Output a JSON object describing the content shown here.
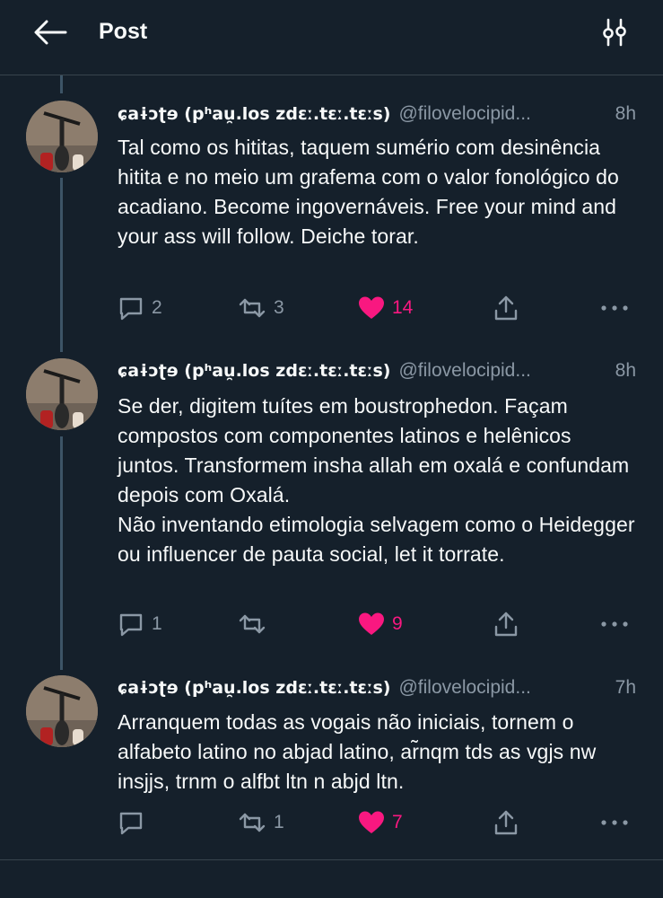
{
  "header": {
    "title": "Post",
    "back_icon": "arrow-left-icon",
    "settings_icon": "sliders-icon"
  },
  "colors": {
    "background": "#15202b",
    "text": "#f7f9f9",
    "muted": "#8b98a5",
    "like": "#f91880",
    "divider": "#38444d"
  },
  "tweets": [
    {
      "name": "ɕaɨɔʈɘ (pʰau̯.los zdɛː.tɛː.tɛːs)",
      "handle": "@filovelocipid...",
      "time": "8h",
      "text": "Tal como os hititas, taquem sumério com desinência hitita e no meio um grafema com o valor fonológico do acadiano. Become ingovernáveis. Free your mind and your ass will follow. Deiche torar.",
      "replies": "2",
      "retweets": "3",
      "likes": "14",
      "liked": true
    },
    {
      "name": "ɕaɨɔʈɘ (pʰau̯.los zdɛː.tɛː.tɛːs)",
      "handle": "@filovelocipid...",
      "time": "8h",
      "text": "Se der, digitem tuítes em boustrophedon. Façam compostos com componentes latinos e helênicos juntos. Transformem insha allah em oxalá e confundam depois com Oxalá.\nNão inventando etimologia selvagem como o Heidegger ou influencer de pauta social, let it torrate.",
      "replies": "1",
      "retweets": "",
      "likes": "9",
      "liked": true
    },
    {
      "name": "ɕaɨɔʈɘ (pʰau̯.los zdɛː.tɛː.tɛːs)",
      "handle": "@filovelocipid...",
      "time": "7h",
      "text": "Arranquem todas as vogais não iniciais, tornem o alfabeto latino no abjad latino, ar̃nqm tds as vgjs nw insjjs, trnm o alfbt ltn n abjd ltn.",
      "replies": "",
      "retweets": "1",
      "likes": "7",
      "liked": true
    }
  ]
}
